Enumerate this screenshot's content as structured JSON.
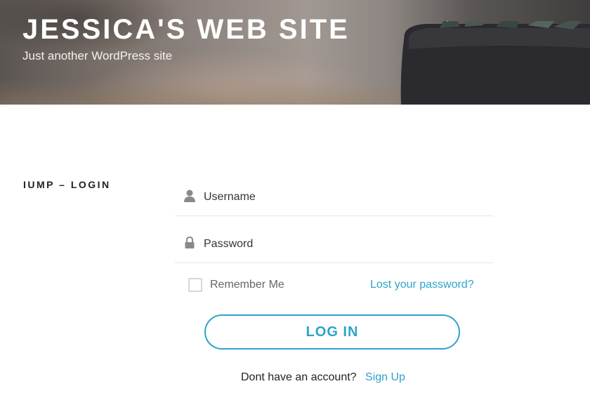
{
  "header": {
    "site_title": "JESSICA'S WEB SITE",
    "tagline": "Just another WordPress site"
  },
  "login": {
    "widget_title": "IUMP – LOGIN",
    "username_placeholder": "Username",
    "username_icon": "user-icon",
    "password_placeholder": "Password",
    "password_icon": "lock-icon",
    "remember_label": "Remember Me",
    "remember_checked": false,
    "lost_password": "Lost your password?",
    "login_button": "LOG IN",
    "signup_prompt": "Dont have an account?",
    "signup_link": "Sign Up"
  },
  "colors": {
    "accent": "#2ea3c9",
    "text": "#222222",
    "muted": "#666666"
  }
}
